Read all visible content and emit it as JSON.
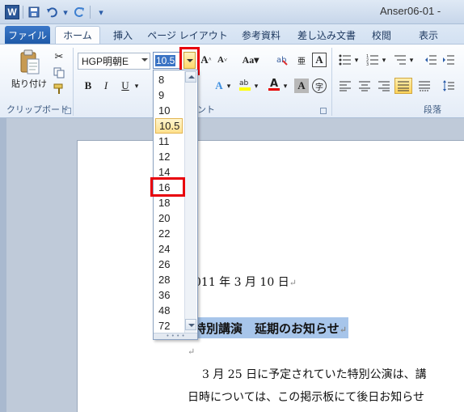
{
  "window": {
    "title": "Anser06-01 -"
  },
  "tabs": {
    "file": "ファイル",
    "home": "ホーム",
    "insert": "挿入",
    "page_layout": "ページ レイアウト",
    "references": "参考資料",
    "mailings": "差し込み文書",
    "review": "校閲",
    "view": "表示"
  },
  "ribbon": {
    "clipboard": {
      "paste_label": "貼り付け",
      "group_label": "クリップボード"
    },
    "font": {
      "font_name": "HGP明朝E",
      "font_size": "10.5",
      "group_label": "ント"
    },
    "paragraph": {
      "group_label": "段落"
    }
  },
  "font_size_list": {
    "items": [
      "8",
      "9",
      "10",
      "10.5",
      "11",
      "12",
      "14",
      "16",
      "18",
      "20",
      "22",
      "24",
      "26",
      "28",
      "36",
      "48",
      "72"
    ],
    "current": "10.5",
    "target": "16"
  },
  "document": {
    "date_line": "011 年 3 月 10 日",
    "title_line": "特別講演　延期のお知らせ",
    "body_line1": "3 月 25 日に予定されていた特別公演は、講",
    "body_line2": "日時については、この掲示板にて後日お知らせ"
  },
  "colors": {
    "highlight_box": "#e8000b",
    "selection": "#a7c5ea",
    "accent": "#2b5797"
  }
}
